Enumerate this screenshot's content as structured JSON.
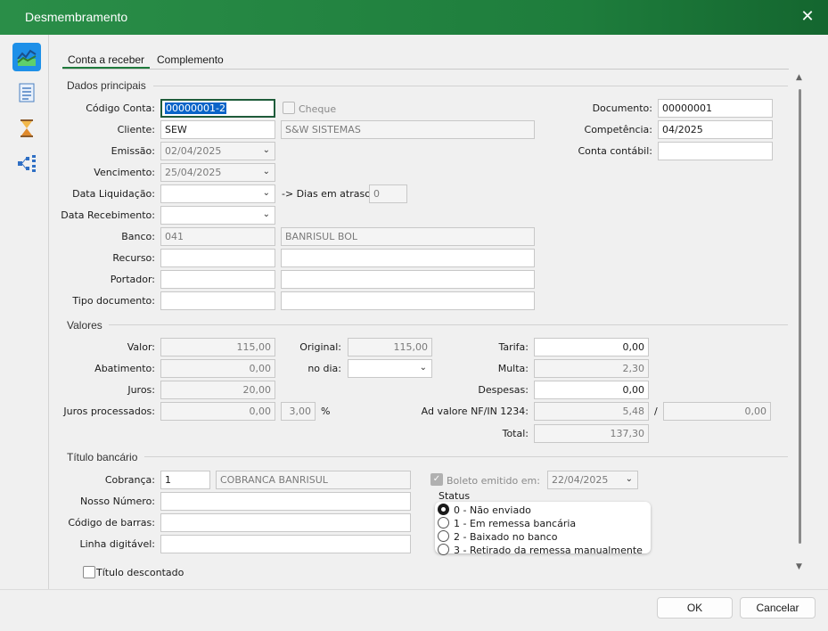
{
  "window": {
    "title": "Desmembramento"
  },
  "tabs": [
    {
      "label": "Conta a receber"
    },
    {
      "label": "Complemento"
    }
  ],
  "sections": {
    "principal": "Dados principais",
    "valores": "Valores",
    "titulo": "Título bancário"
  },
  "principal": {
    "codigo_conta": {
      "label": "Código Conta:",
      "value": "00000001-2"
    },
    "cheque": {
      "label": "Cheque"
    },
    "documento": {
      "label": "Documento:",
      "value": "00000001"
    },
    "cliente": {
      "label": "Cliente:",
      "code": "SEW",
      "name": "S&W SISTEMAS"
    },
    "competencia": {
      "label": "Competência:",
      "value": "04/2025"
    },
    "emissao": {
      "label": "Emissão:",
      "value": "02/04/2025"
    },
    "conta_contabil": {
      "label": "Conta contábil:",
      "value": ""
    },
    "vencimento": {
      "label": "Vencimento:",
      "value": "25/04/2025"
    },
    "data_liquidacao": {
      "label": "Data Liquidação:",
      "value": ""
    },
    "dias_atraso": {
      "label": "-> Dias em atraso:",
      "value": "0"
    },
    "data_recebimento": {
      "label": "Data Recebimento:",
      "value": ""
    },
    "banco": {
      "label": "Banco:",
      "code": "041",
      "name": "BANRISUL BOL"
    },
    "recurso": {
      "label": "Recurso:",
      "code": "",
      "name": ""
    },
    "portador": {
      "label": "Portador:",
      "code": "",
      "name": ""
    },
    "tipo_documento": {
      "label": "Tipo documento:",
      "code": "",
      "name": ""
    }
  },
  "valores": {
    "valor": {
      "label": "Valor:",
      "value": "115,00"
    },
    "original": {
      "label": "Original:",
      "value": "115,00"
    },
    "tarifa": {
      "label": "Tarifa:",
      "value": "0,00"
    },
    "abatimento": {
      "label": "Abatimento:",
      "value": "0,00"
    },
    "no_dia": {
      "label": "no dia:",
      "value": ""
    },
    "multa": {
      "label": "Multa:",
      "value": "2,30"
    },
    "juros": {
      "label": "Juros:",
      "value": "20,00"
    },
    "despesas": {
      "label": "Despesas:",
      "value": "0,00"
    },
    "juros_processados": {
      "label": "Juros processados:",
      "value": "0,00",
      "percent": "3,00",
      "percent_symbol": "%"
    },
    "ad_valore": {
      "label": "Ad valore NF/IN 1234:",
      "value": "5,48",
      "separator": "/",
      "value2": "0,00"
    },
    "total": {
      "label": "Total:",
      "value": "137,30"
    }
  },
  "titulo": {
    "cobranca": {
      "label": "Cobrança:",
      "code": "1",
      "name": "COBRANCA BANRISUL"
    },
    "boleto_emitido": {
      "label": "Boleto emitido em:",
      "value": "22/04/2025"
    },
    "nosso_numero": {
      "label": "Nosso Número:",
      "value": ""
    },
    "codigo_barras": {
      "label": "Código de barras:",
      "value": ""
    },
    "linha_digitavel": {
      "label": "Linha digitável:",
      "value": ""
    },
    "status": {
      "label": "Status",
      "options": [
        {
          "label": "0 - Não enviado"
        },
        {
          "label": "1 - Em remessa bancária"
        },
        {
          "label": "2 - Baixado no banco"
        },
        {
          "label": "3 - Retirado da remessa manualmente"
        }
      ]
    },
    "titulo_descontado": {
      "label": "Título descontado"
    }
  },
  "buttons": {
    "ok": "OK",
    "cancel": "Cancelar"
  },
  "icons": {
    "close": "close-icon",
    "nav": [
      "chart-icon",
      "document-list-icon",
      "hourglass-icon",
      "hierarchy-icon"
    ]
  }
}
